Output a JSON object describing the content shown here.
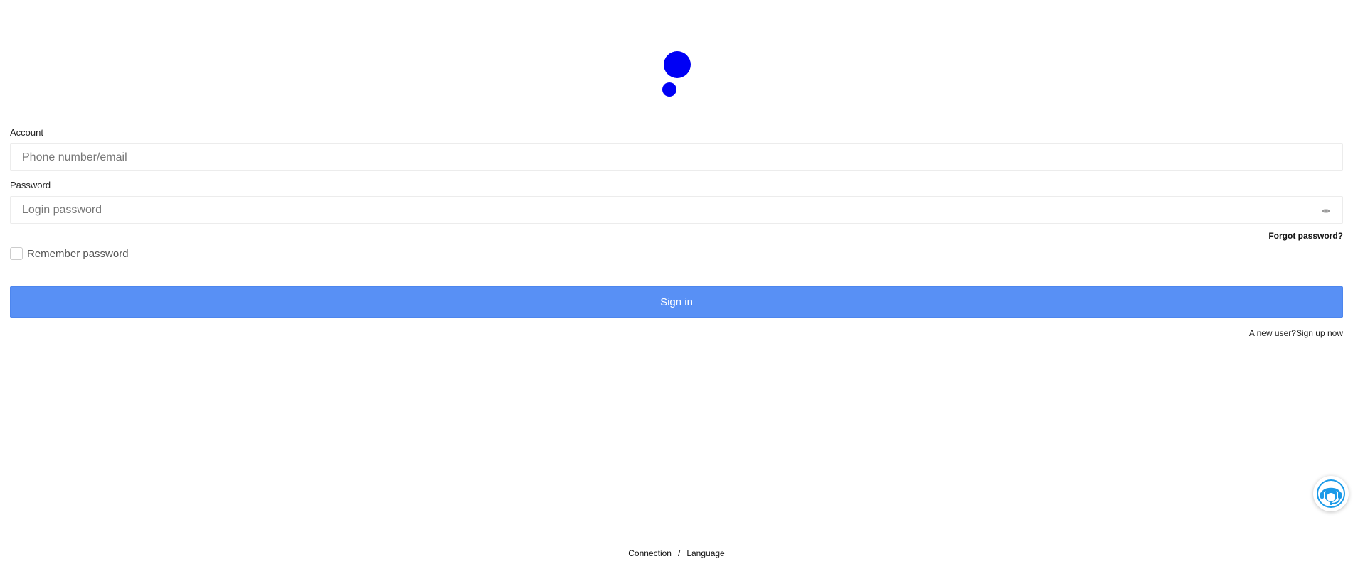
{
  "logo": {
    "icon": "two-dots-logo-icon",
    "color": "#0000f5"
  },
  "form": {
    "account": {
      "label": "Account",
      "placeholder": "Phone number/email",
      "value": ""
    },
    "password": {
      "label": "Password",
      "placeholder": "Login password",
      "value": "",
      "toggle_icon": "eye-icon"
    },
    "forgot_label": "Forgot password?",
    "remember": {
      "label": "Remember password",
      "checked": false
    },
    "signin_label": "Sign in",
    "signup": {
      "prompt": "A new user?",
      "link_label": "Sign up now"
    }
  },
  "support": {
    "icon": "customer-service-headset-icon",
    "color": "#1a9ae8"
  },
  "footer": {
    "connection_label": "Connection",
    "separator": "/",
    "language_label": "Language"
  },
  "colors": {
    "primary_button": "#5890f5",
    "brand": "#0000f5"
  }
}
